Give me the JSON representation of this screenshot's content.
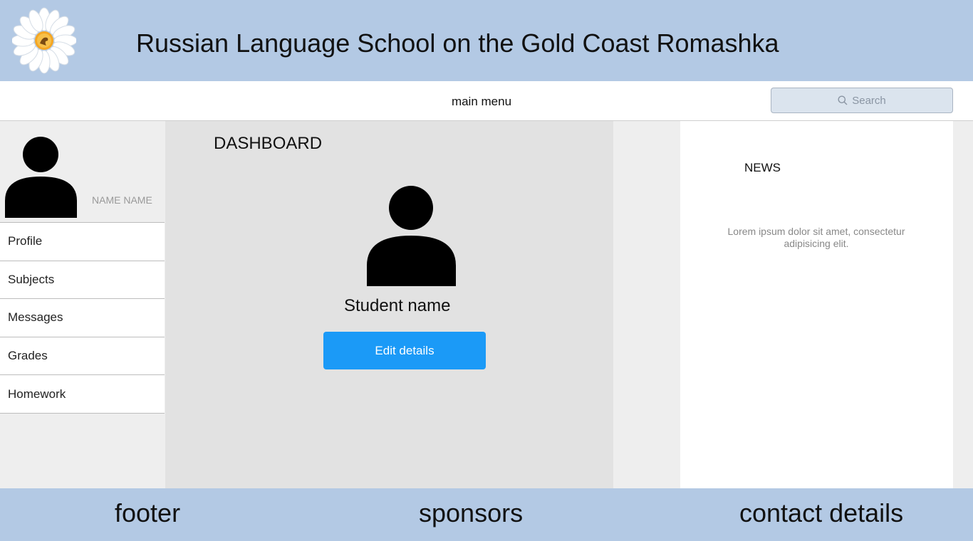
{
  "header": {
    "title": "Russian Language School on the Gold Coast Romashka",
    "logo_icon": "daisy-kangaroo-logo-icon"
  },
  "menubar": {
    "label": "main menu",
    "search_placeholder": "Search"
  },
  "sidebar": {
    "user_name": "NAME NAME",
    "items": [
      {
        "label": "Profile"
      },
      {
        "label": "Subjects"
      },
      {
        "label": "Messages"
      },
      {
        "label": "Grades"
      },
      {
        "label": "Homework"
      }
    ]
  },
  "main": {
    "title": "DASHBOARD",
    "student_name": "Student name",
    "edit_button": "Edit details"
  },
  "news": {
    "title": "NEWS",
    "text": "Lorem ipsum dolor sit amet, consectetur adipisicing elit."
  },
  "footer": {
    "footer_label": "footer",
    "sponsors_label": "sponsors",
    "contact_label": "contact details"
  },
  "colors": {
    "header_bg": "#b3c9e4",
    "button_bg": "#1b9af7"
  }
}
